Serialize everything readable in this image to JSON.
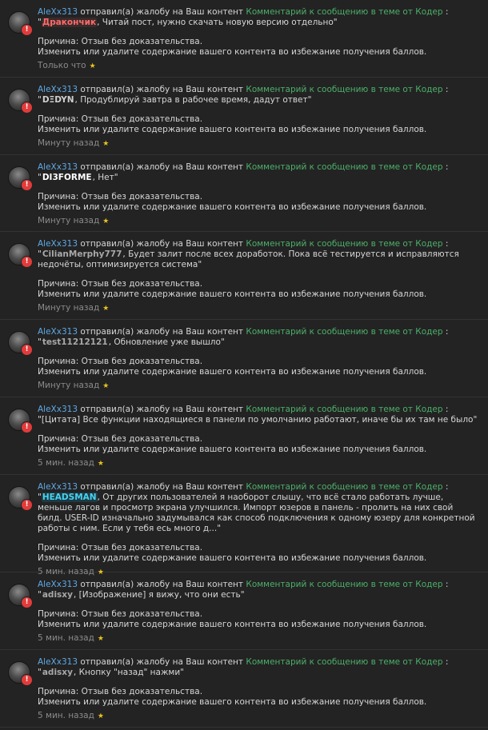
{
  "common": {
    "action_text": " отправил(а) жалобу на Ваш контент ",
    "topic_link": "Комментарий к сообщению в теме от Кодер",
    "colon": " :",
    "reason_line": "Причина: Отзыв без доказательства.",
    "instruction_line": "Изменить или удалите содержание вашего контента во избежание получения баллов.",
    "alert_glyph": "!",
    "star_glyph": "★"
  },
  "colors": {
    "background": "#232323",
    "user_link": "#5fa9e6",
    "topic_link": "#4caf6a",
    "alert": "#e23b3b",
    "star": "#e8c21f"
  },
  "notifications": [
    {
      "user": "AleXx313",
      "open_quote": "\"",
      "quoted_name": "Дракончик",
      "name_color": "#ff6b6b",
      "name_bg": "#3a2a2a",
      "quote_text": ", Читай пост, нужно скачать новую версию отдельно\"",
      "time": "Только что"
    },
    {
      "user": "AleXx313",
      "open_quote": "\"",
      "quoted_name": "DΞDYN",
      "name_color": "#cfcfcf",
      "name_bg": "",
      "quote_text": ", Продублируй завтра в рабочее время, дадут ответ\"",
      "time": "Минуту назад"
    },
    {
      "user": "AleXx313",
      "open_quote": "\"",
      "quoted_name": "DI3FORME",
      "name_color": "#ffffff",
      "name_bg": "",
      "quote_text": ", Нет\"",
      "time": "Минуту назад"
    },
    {
      "user": "AleXx313",
      "open_quote": "\"",
      "quoted_name": "CilianMerphy777",
      "name_color": "#a8a8a8",
      "name_bg": "",
      "quote_text": ", Будет залит после всех доработок. Пока всё тестируется и исправляются недочёты, оптимизируется система\"",
      "time": "Минуту назад"
    },
    {
      "user": "AleXx313",
      "open_quote": "\"",
      "quoted_name": "test11212121",
      "name_color": "#a8a8a8",
      "name_bg": "",
      "quote_text": ", Обновление уже вышло\"",
      "time": "Минуту назад"
    },
    {
      "user": "AleXx313",
      "open_quote": "\"",
      "quoted_name": "",
      "name_color": "#a8a8a8",
      "name_bg": "",
      "quote_text": "[Цитата] Все функции находящиеся в панели по умолчанию работают, иначе бы их там не было\"",
      "time": "5 мин. назад"
    },
    {
      "user": "AleXx313",
      "open_quote": "\"",
      "quoted_name": "HEADSMAN",
      "name_color": "#46d2f0",
      "name_bg": "#1f3a44",
      "quote_text": ", От других пользователей я наоборот слышу, что всё стало работать лучше, меньше лагов и просмотр экрана улучшился. Импорт юзеров в панель - пролить на них свой билд. USER-ID изначально задумывался как способ подключения к одному юзеру для конкретной работы с ним. Если у тебя есь много д...\"",
      "time": "5 мин. назад"
    },
    {
      "user": "AleXx313",
      "open_quote": "\"",
      "quoted_name": "adisxy",
      "name_color": "#a8a8a8",
      "name_bg": "",
      "quote_text": ", [Изображение] я вижу, что они есть\"",
      "time": "5 мин. назад"
    },
    {
      "user": "AleXx313",
      "open_quote": "\"",
      "quoted_name": "adisxy",
      "name_color": "#a8a8a8",
      "name_bg": "",
      "quote_text": ", Кнопку \"назад\" нажми\"",
      "time": "5 мин. назад"
    }
  ]
}
